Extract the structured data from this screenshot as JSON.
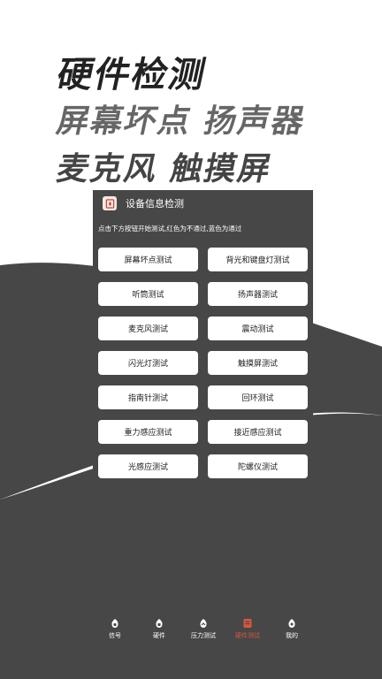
{
  "hero": {
    "line1": "硬件检测",
    "line2": "屏幕坏点 扬声器",
    "line3": "麦克风 触摸屏"
  },
  "app": {
    "title": "设备信息检测",
    "hint": "点击下方按钮开始测试,红色为不通过,蓝色为通过",
    "buttons": [
      [
        "屏幕坏点测试",
        "背光和键盘灯测试"
      ],
      [
        "听筒测试",
        "扬声器测试"
      ],
      [
        "麦克风测试",
        "震动测试"
      ],
      [
        "闪光灯测试",
        "触摸屏测试"
      ],
      [
        "指南针测试",
        "回环测试"
      ],
      [
        "重力感应测试",
        "接近感应测试"
      ],
      [
        "光感应测试",
        "陀螺仪测试"
      ]
    ]
  },
  "tabs": [
    {
      "label": "信号",
      "icon": "signal-icon",
      "active": false
    },
    {
      "label": "硬件",
      "icon": "chip-icon",
      "active": false
    },
    {
      "label": "压力测试",
      "icon": "gauge-icon",
      "active": false
    },
    {
      "label": "硬件测试",
      "icon": "test-icon",
      "active": true
    },
    {
      "label": "我的",
      "icon": "user-icon",
      "active": false
    }
  ],
  "colors": {
    "dark_bg": "#474747",
    "accent": "#d9573f"
  }
}
